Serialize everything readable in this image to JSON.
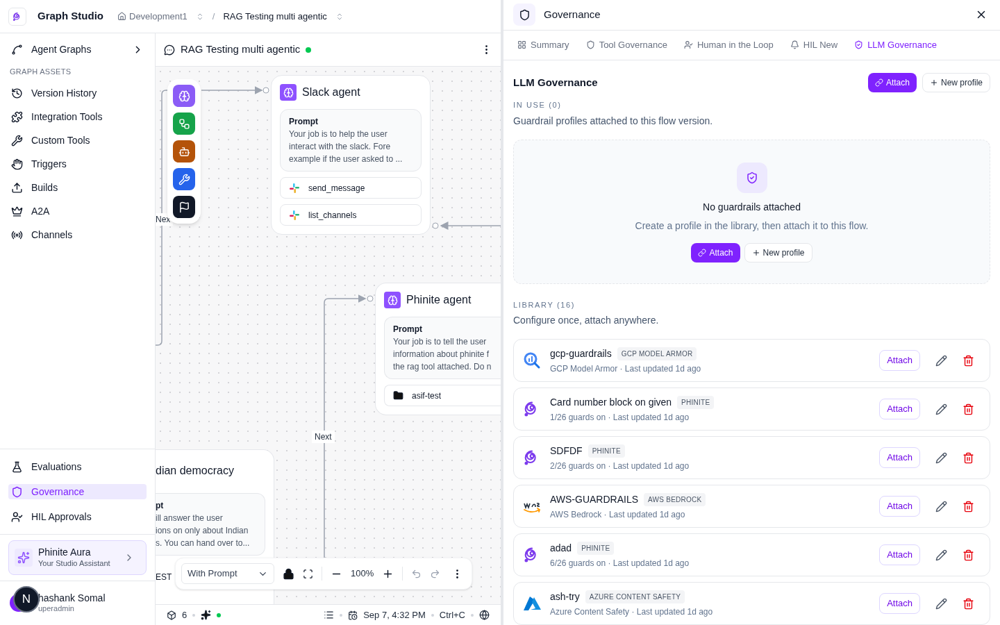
{
  "app": {
    "name": "Graph Studio"
  },
  "breadcrumbs": [
    {
      "label": "Development1",
      "kind": "home"
    },
    {
      "label": "RAG Testing multi agentic",
      "kind": "current"
    }
  ],
  "breadcrumb_separator": "/",
  "sidebar": {
    "top_item": {
      "label": "Agent Graphs"
    },
    "section_title": "GRAPH ASSETS",
    "items": [
      {
        "label": "Version History",
        "kind": "history"
      },
      {
        "label": "Integration Tools",
        "kind": "puzzle"
      },
      {
        "label": "Custom Tools",
        "kind": "wrench"
      },
      {
        "label": "Triggers",
        "kind": "hand"
      },
      {
        "label": "Builds",
        "kind": "upload"
      },
      {
        "label": "A2A",
        "kind": "crown"
      },
      {
        "label": "Channels",
        "kind": "radio"
      }
    ],
    "bottom_items": [
      {
        "label": "Evaluations",
        "kind": "flask",
        "selected": false
      },
      {
        "label": "Governance",
        "kind": "shield",
        "selected": true
      },
      {
        "label": "HIL Approvals",
        "kind": "user-check",
        "selected": false
      }
    ],
    "assistant": {
      "title": "Phinite Aura",
      "subtitle": "Your Studio Assistant"
    },
    "user": {
      "name": "hashank Somal",
      "role": "uperadmin"
    },
    "dev_badge": "N"
  },
  "canvas": {
    "title": "RAG Testing multi agentic",
    "online": true,
    "palette": [
      {
        "kind": "brain",
        "color": "#8b5cf6"
      },
      {
        "kind": "flow",
        "color": "#16a34a"
      },
      {
        "kind": "bot",
        "color": "#b45309"
      },
      {
        "kind": "wrench",
        "color": "#2563eb"
      },
      {
        "kind": "flag",
        "color": "#111827"
      }
    ],
    "edge_labels": [
      "Nex",
      "Next"
    ],
    "nodes": [
      {
        "title": "Slack agent",
        "prompt_label": "Prompt",
        "prompt": "Your job is to help the user interact with the slack. Fore example if the user asked to ...",
        "tools": [
          {
            "label": "send_message",
            "kind": "slack"
          },
          {
            "label": "list_channels",
            "kind": "slack"
          }
        ]
      },
      {
        "title": "Phinite agent",
        "prompt_label": "Prompt",
        "prompt_lines": [
          "Your job is to tell the user",
          "information about phinite f",
          "the rag tool attached. Do n"
        ],
        "tools": [
          {
            "label": "asif-test",
            "kind": "folder"
          }
        ]
      },
      {
        "title": "dian democracy",
        "prompt_label": "pt",
        "prompt_lines": [
          "ill answer the user",
          "ions on only about Indian",
          "s. You can hand over to..."
        ],
        "footer": "EST"
      }
    ],
    "toolbar": {
      "mode": "With Prompt",
      "zoom": "100%"
    },
    "status": {
      "count": "6",
      "assistant_online": true,
      "date": "Sep 7, 4:32 PM",
      "shortcut": "Ctrl+C"
    }
  },
  "panel": {
    "title": "Governance",
    "tabs": [
      {
        "label": "Summary",
        "kind": "grid",
        "selected": false
      },
      {
        "label": "Tool Governance",
        "kind": "shield",
        "selected": false
      },
      {
        "label": "Human in the Loop",
        "kind": "user",
        "selected": false
      },
      {
        "label": "HIL New",
        "kind": "bell",
        "selected": false
      },
      {
        "label": "LLM Governance",
        "kind": "shield-check",
        "selected": true
      }
    ],
    "section_title": "LLM Governance",
    "attach": "Attach",
    "new_profile": "New profile",
    "in_use": {
      "label": "IN USE (0)",
      "description": "Guardrail profiles attached to this flow version.",
      "empty_title": "No guardrails attached",
      "empty_text": "Create a profile in the library, then attach it to this flow.",
      "attach": "Attach",
      "new_profile": "New profile"
    },
    "library": {
      "label": "LIBRARY (16)",
      "description": "Configure once, attach anywhere.",
      "profiles": [
        {
          "name": "gcp-guardrails",
          "tag": "GCP MODEL ARMOR",
          "meta": "GCP Model Armor · Last updated 1d ago",
          "kind": "gcp",
          "action": "Attach"
        },
        {
          "name": "Card number block on given",
          "tag": "PHINITE",
          "meta": "1/26 guards on · Last updated 1d ago",
          "kind": "phinite",
          "action": "Attach"
        },
        {
          "name": "SDFDF",
          "tag": "PHINITE",
          "meta": "2/26 guards on · Last updated 1d ago",
          "kind": "phinite",
          "action": "Attach"
        },
        {
          "name": "AWS-GUARDRAILS",
          "tag": "AWS BEDROCK",
          "meta": "AWS Bedrock · Last updated 1d ago",
          "kind": "aws",
          "action": "Attach"
        },
        {
          "name": "adad",
          "tag": "PHINITE",
          "meta": "6/26 guards on · Last updated 1d ago",
          "kind": "phinite",
          "action": "Attach"
        },
        {
          "name": "ash-try",
          "tag": "AZURE CONTENT SAFETY",
          "meta": "Azure Content Safety · Last updated 1d ago",
          "kind": "azure",
          "action": "Attach"
        }
      ]
    }
  }
}
